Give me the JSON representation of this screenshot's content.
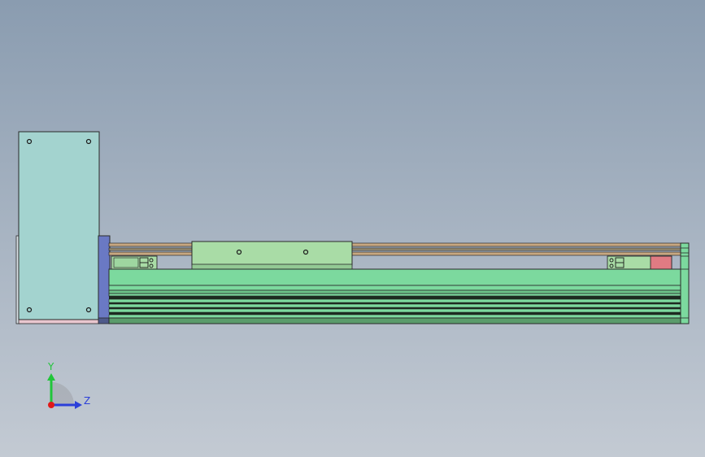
{
  "app": {
    "view_type": "cad-orthographic-view"
  },
  "colors": {
    "background_top": "#8a9cb0",
    "background_bottom": "#c3cad3",
    "motor_plate": "#a3d3cf",
    "motor_flange": "#6a79c4",
    "rail_body": "#7cd99e",
    "rail_dark": "#5a9c6b",
    "carriage": "#a9dca6",
    "screw_rail": "#c7a780",
    "end_stop": "#e07b83",
    "pink_base": "#e9c7cf",
    "axis_y": "#21c53a",
    "axis_z": "#2b3fd9",
    "axis_origin": "#e01919"
  },
  "triad": {
    "y_label": "Y",
    "z_label": "Z",
    "y_icon": "axis-y-arrow",
    "z_icon": "axis-z-arrow"
  }
}
